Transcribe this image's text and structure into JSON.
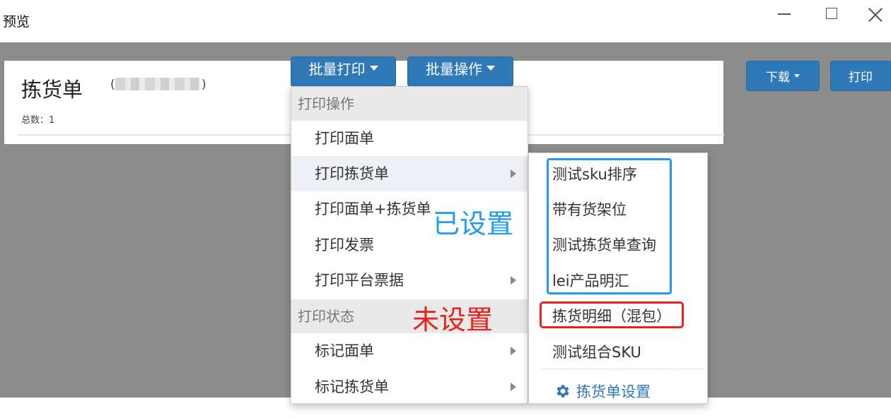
{
  "window": {
    "title": "预览"
  },
  "preview": {
    "title": "拣货单",
    "paren_open": "(",
    "paren_close": ")",
    "total_label": "总数：1"
  },
  "toolbar": {
    "batch_print": "批量打印",
    "batch_ops": "批量操作",
    "download": "下载",
    "print": "打印"
  },
  "menu": {
    "header_print_ops": "打印操作",
    "items_print": [
      {
        "label": "打印面单",
        "has_submenu": false
      },
      {
        "label": "打印拣货单",
        "has_submenu": true,
        "active": true
      },
      {
        "label": "打印面单+拣货单",
        "has_submenu": false
      },
      {
        "label": "打印发票",
        "has_submenu": false
      },
      {
        "label": "打印平台票据",
        "has_submenu": true
      }
    ],
    "header_print_status": "打印状态",
    "items_status": [
      {
        "label": "标记面单",
        "has_submenu": true
      },
      {
        "label": "标记拣货单",
        "has_submenu": true
      }
    ]
  },
  "submenu": {
    "items": [
      "测试sku排序",
      "带有货架位",
      "测试拣货单查询",
      "lei产品明汇",
      "拣货明细（混包）",
      "测试组合SKU"
    ],
    "settings_label": "拣货单设置"
  },
  "annotations": {
    "configured": "已设置",
    "not_configured": "未设置",
    "configured_color": "#1f9bf0",
    "not_configured_color": "#e8221a"
  }
}
